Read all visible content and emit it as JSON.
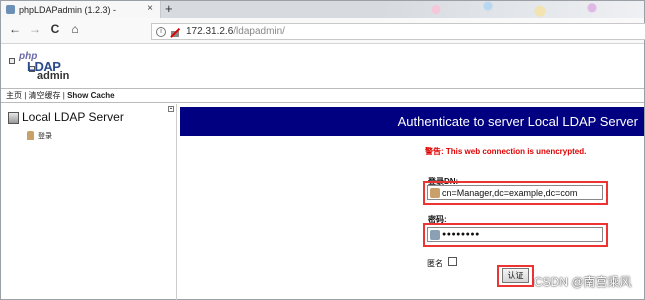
{
  "browser": {
    "tab_title": "phpLDAPadmin (1.2.3) -",
    "tab_close": "×",
    "new_tab": "+",
    "back": "←",
    "forward": "→",
    "reload": "C",
    "home": "⌂",
    "url_host": "172.31.2.6",
    "url_path": "/ldapadmin/"
  },
  "logo": {
    "php": "php",
    "ldap": "LDAP",
    "admin": "admin"
  },
  "menu": {
    "home": "主页",
    "sep1": " | ",
    "clear_cache": "清空缓存",
    "sep2": " | ",
    "show_cache": "Show Cache"
  },
  "left": {
    "server_name": "Local LDAP Server",
    "login_link": "登录"
  },
  "main": {
    "title": "Authenticate to server Local LDAP Server",
    "warning": "警告: This web connection is unencrypted.",
    "dn_label": "登录DN:",
    "dn_value": "cn=Manager,dc=example,dc=com",
    "password_label": "密码:",
    "password_value": "●●●●●●●●",
    "anon_label": "匿名",
    "submit_label": "认证"
  },
  "watermark": "CSDN @南宫乘风"
}
